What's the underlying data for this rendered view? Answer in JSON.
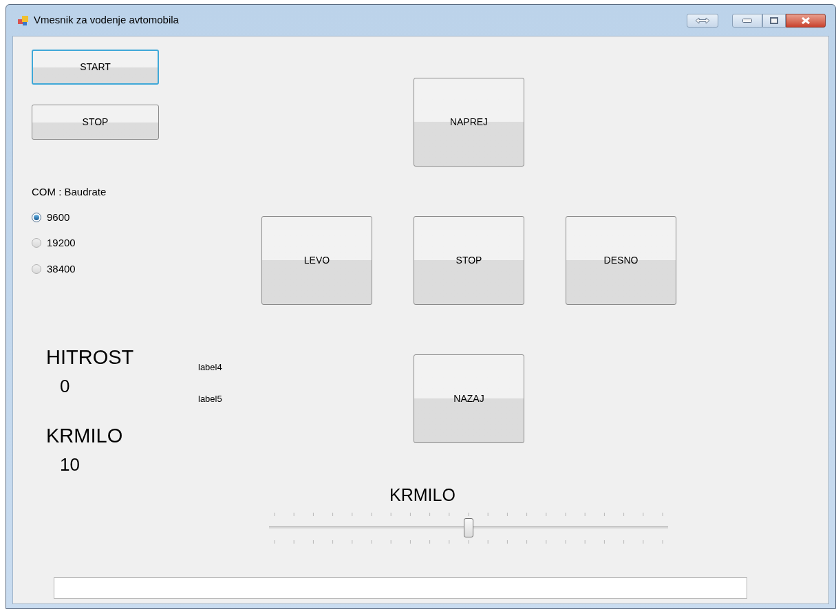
{
  "window": {
    "title": "Vmesnik za vodenje avtomobila"
  },
  "control_buttons": [
    {
      "label": "START",
      "focused": true
    },
    {
      "label": "STOP",
      "focused": false
    }
  ],
  "baudrate": {
    "label": "COM : Baudrate",
    "options": [
      {
        "label": "9600",
        "selected": true
      },
      {
        "label": "19200",
        "selected": false
      },
      {
        "label": "38400",
        "selected": false
      }
    ]
  },
  "readouts": [
    {
      "label": "HITROST",
      "value": "0"
    },
    {
      "label": "KRMILO",
      "value": "10"
    }
  ],
  "debug_labels": [
    "label4",
    "label5"
  ],
  "direction_buttons": [
    {
      "label": "NAPREJ",
      "kind": "up"
    },
    {
      "label": "LEVO",
      "kind": "left"
    },
    {
      "label": "STOP",
      "kind": "center"
    },
    {
      "label": "DESNO",
      "kind": "right"
    },
    {
      "label": "NAZAJ",
      "kind": "down"
    }
  ],
  "steering_slider": {
    "label": "KRMILO",
    "level": 0.5
  }
}
